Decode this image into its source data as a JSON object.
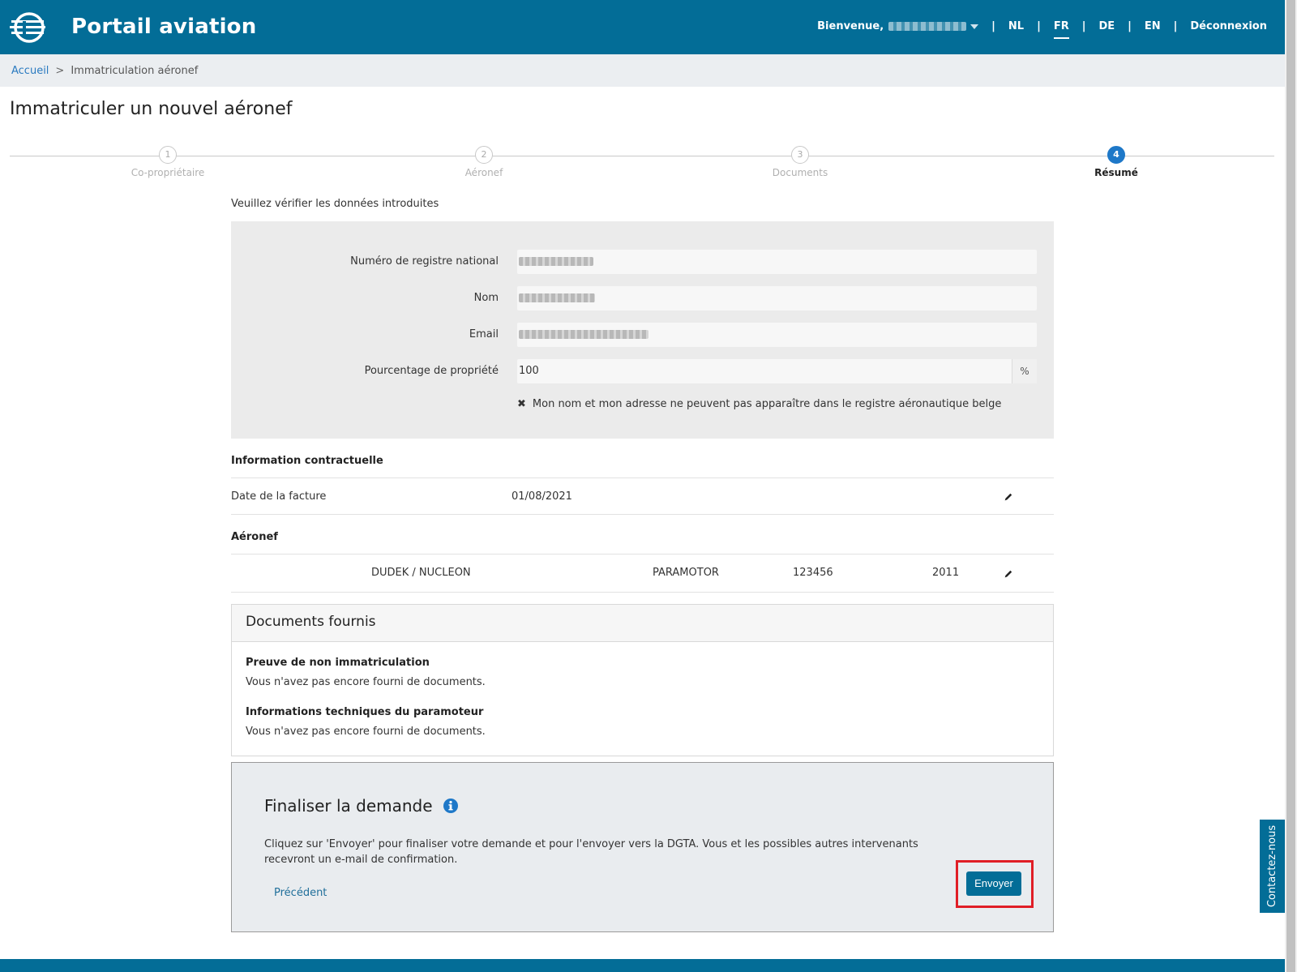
{
  "header": {
    "app_title": "Portail aviation",
    "welcome_label": "Bienvenue,",
    "languages": [
      "NL",
      "FR",
      "DE",
      "EN"
    ],
    "active_language": "FR",
    "logout_label": "Déconnexion",
    "brand_color": "#036d97"
  },
  "breadcrumb": {
    "home": "Accueil",
    "separator": ">",
    "current": "Immatriculation aéronef"
  },
  "page_title": "Immatriculer un nouvel aéronef",
  "stepper": {
    "steps": [
      {
        "number": "1",
        "label": "Co-propriétaire"
      },
      {
        "number": "2",
        "label": "Aéronef"
      },
      {
        "number": "3",
        "label": "Documents"
      },
      {
        "number": "4",
        "label": "Résumé"
      }
    ],
    "active_step": 4
  },
  "summary": {
    "intro": "Veuillez vérifier les données introduites",
    "fields": {
      "national_register_label": "Numéro de registre national",
      "name_label": "Nom",
      "email_label": "Email",
      "ownership_label": "Pourcentage de propriété",
      "ownership_value": "100",
      "ownership_unit": "%"
    },
    "privacy_note": "Mon nom et mon adresse ne peuvent pas apparaître dans le registre aéronautique belge"
  },
  "contract": {
    "section_title": "Information contractuelle",
    "invoice_date_label": "Date de la facture",
    "invoice_date_value": "01/08/2021"
  },
  "aircraft": {
    "section_title": "Aéronef",
    "model": "DUDEK / NUCLEON",
    "type": "PARAMOTOR",
    "serial": "123456",
    "year": "2011"
  },
  "documents": {
    "title": "Documents fournis",
    "items": [
      {
        "title": "Preuve de non immatriculation",
        "status": "Vous n'avez pas encore fourni de documents."
      },
      {
        "title": "Informations techniques du paramoteur",
        "status": "Vous n'avez pas encore fourni de documents."
      }
    ]
  },
  "finalize": {
    "title": "Finaliser la demande",
    "text": "Cliquez sur 'Envoyer' pour finaliser votre demande et pour l'envoyer vers la DGTA. Vous et les possibles autres intervenants recevront un e-mail de confirmation.",
    "previous_label": "Précédent",
    "send_label": "Envoyer"
  },
  "contact_tab_label": "Contactez-nous"
}
